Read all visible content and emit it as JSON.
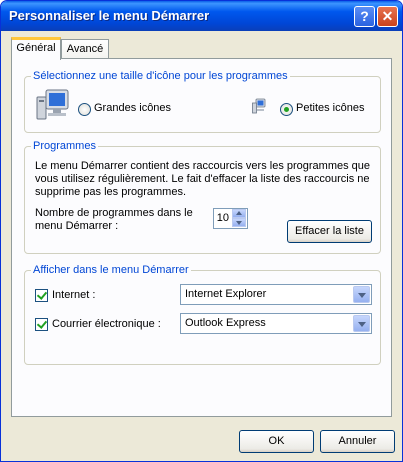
{
  "window": {
    "title": "Personnaliser le menu Démarrer",
    "help": "?",
    "close": "✕"
  },
  "tabs": [
    {
      "label": "Général",
      "active": true
    },
    {
      "label": "Avancé",
      "active": false
    }
  ],
  "icon_size": {
    "legend": "Sélectionnez une taille d'icône pour les programmes",
    "large_label": "Grandes icônes",
    "small_label": "Petites icônes",
    "selected": "small"
  },
  "programs": {
    "legend": "Programmes",
    "description": "Le menu Démarrer contient des raccourcis vers les programmes que vous utilisez régulièrement. Le fait d'effacer la liste des raccourcis ne supprime pas les programmes.",
    "count_label_line1": "Nombre de programmes dans le",
    "count_label_line2": "menu Démarrer :",
    "count_value": "10",
    "clear_button": "Effacer la liste"
  },
  "show_in_menu": {
    "legend": "Afficher dans le menu Démarrer",
    "internet_label": "Internet :",
    "internet_checked": true,
    "internet_value": "Internet Explorer",
    "email_label": "Courrier électronique :",
    "email_checked": true,
    "email_value": "Outlook Express"
  },
  "buttons": {
    "ok": "OK",
    "cancel": "Annuler"
  },
  "colors": {
    "titlebar": "#0058ee",
    "legend": "#0046d5",
    "window_bg": "#ece9d8",
    "tab_highlight": "#ffc73c"
  }
}
